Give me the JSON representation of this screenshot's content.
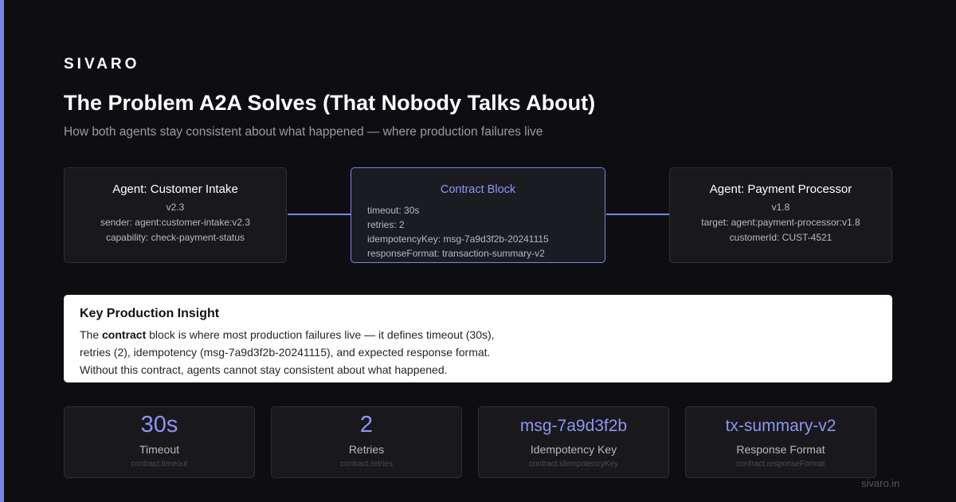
{
  "brand": "SIVARO",
  "title": "The Problem A2A Solves (That Nobody Talks About)",
  "subtitle": "How both agents stay consistent about what happened — where production failures live",
  "nodes": {
    "intake": {
      "title": "Agent: Customer Intake",
      "version": "v2.3",
      "lines": [
        "sender: agent:customer-intake:v2.3",
        "capability: check-payment-status"
      ]
    },
    "contract": {
      "title": "Contract Block",
      "fields": [
        "timeout: 30s",
        "retries: 2",
        "idempotencyKey: msg-7a9d3f2b-20241115",
        "responseFormat: transaction-summary-v2"
      ]
    },
    "payment": {
      "title": "Agent: Payment Processor",
      "version": "v1.8",
      "lines": [
        "target: agent:payment-processor:v1.8",
        "customerId: CUST-4521"
      ]
    }
  },
  "insight": {
    "title": "Key Production Insight",
    "line1_pre": "The ",
    "line1_bold": "contract",
    "line1_post": " block is where most production failures live — it defines timeout (30s),",
    "line2": "retries (2), idempotency (msg-7a9d3f2b-20241115), and expected response format.",
    "line3": "Without this contract, agents cannot stay consistent about what happened."
  },
  "stats": [
    {
      "value": "30s",
      "label": "Timeout",
      "path": "contract.timeout"
    },
    {
      "value": "2",
      "label": "Retries",
      "path": "contract.retries"
    },
    {
      "value": "msg-7a9d3f2b",
      "label": "Idempotency Key",
      "path": "contract.idempotencyKey"
    },
    {
      "value": "tx-summary-v2",
      "label": "Response Format",
      "path": "contract.responseFormat"
    }
  ],
  "footer": "sivaro.in",
  "colors": {
    "background": "#0e0e12",
    "accent": "#7b84e8",
    "card": "#19191d",
    "insight_background": "#ffffff"
  }
}
